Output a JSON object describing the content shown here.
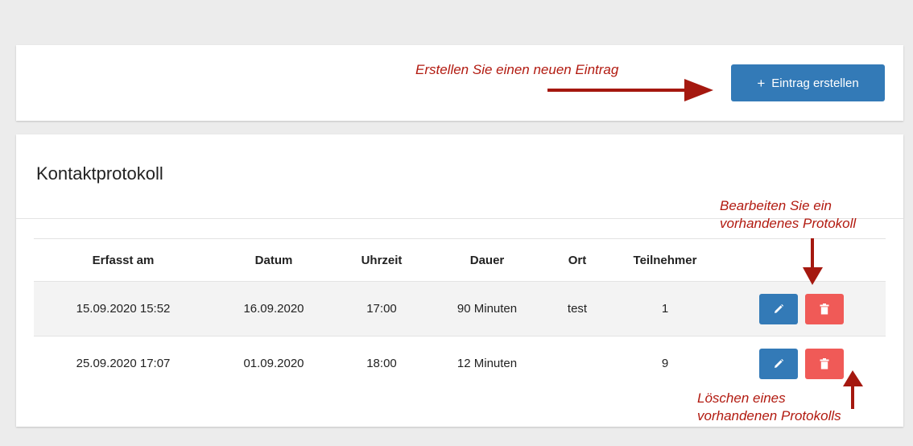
{
  "toolbar": {
    "create_button_label": "Eintrag erstellen",
    "create_button_icon": "plus-icon"
  },
  "protocol": {
    "title": "Kontaktprotokoll",
    "columns": [
      "Erfasst am",
      "Datum",
      "Uhrzeit",
      "Dauer",
      "Ort",
      "Teilnehmer"
    ],
    "rows": [
      {
        "erfasst_am": "15.09.2020 15:52",
        "datum": "16.09.2020",
        "uhrzeit": "17:00",
        "dauer": "90 Minuten",
        "ort": "test",
        "teilnehmer": "1"
      },
      {
        "erfasst_am": "25.09.2020 17:07",
        "datum": "01.09.2020",
        "uhrzeit": "18:00",
        "dauer": "12 Minuten",
        "ort": "",
        "teilnehmer": "9"
      }
    ],
    "row_actions": [
      "pencil-icon",
      "trash-icon"
    ]
  },
  "annotations": {
    "create": "Erstellen Sie einen neuen Eintrag",
    "edit_line1": "Bearbeiten Sie ein",
    "edit_line2": "vorhandenes Protokoll",
    "delete_line1": "Löschen eines",
    "delete_line2": "vorhandenen Protokolls"
  },
  "colors": {
    "primary": "#337ab7",
    "danger": "#f05a57",
    "annotation": "#b21a10",
    "background": "#ececec"
  }
}
